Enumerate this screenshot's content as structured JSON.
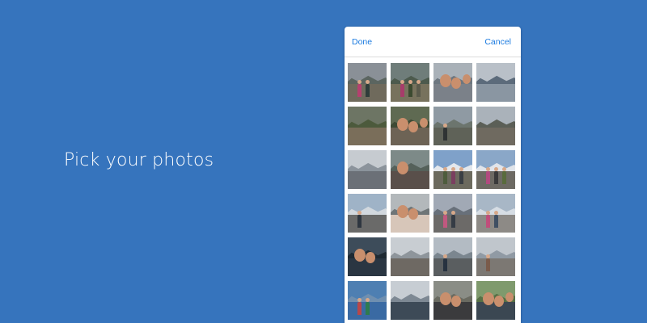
{
  "headline": "Pick your photos",
  "picker": {
    "done_label": "Done",
    "cancel_label": "Cancel",
    "accent": "#1a7ae0"
  },
  "background_color": "#3674bd",
  "photos": [
    {
      "name": "photo-hikers-mountain",
      "sky": "#8a9097",
      "mtn": "#5b6560",
      "ground": "#6f6a5c",
      "figs": [
        "#b5406f",
        "#2f3d3a"
      ]
    },
    {
      "name": "photo-group-trail",
      "sky": "#6f7d7a",
      "mtn": "#4c5a4d",
      "ground": "#77725d",
      "figs": [
        "#a73c6a",
        "#3c4a30",
        "#5b5b4c"
      ]
    },
    {
      "name": "photo-selfie-lake",
      "sky": "#a9b1b8",
      "mtn": "#6d7780",
      "ground": "#7b8189",
      "face": true
    },
    {
      "name": "photo-mountain-lake",
      "sky": "#b9c0c8",
      "mtn": "#5c6b7b",
      "ground": "#8a96a2",
      "figs": []
    },
    {
      "name": "photo-river-rocks",
      "sky": "#6d7564",
      "mtn": "#4c5a3c",
      "ground": "#7a6e5a",
      "figs": []
    },
    {
      "name": "photo-selfie-woman",
      "sky": "#5f6a52",
      "mtn": "#3e4a34",
      "ground": "#6d6355",
      "face": true
    },
    {
      "name": "photo-man-standing",
      "sky": "#8f9aa3",
      "mtn": "#6c756e",
      "ground": "#5f6258",
      "figs": [
        "#2f3334"
      ]
    },
    {
      "name": "photo-road-trees",
      "sky": "#aab2ba",
      "mtn": "#5b5f57",
      "ground": "#6f6a60",
      "figs": []
    },
    {
      "name": "photo-misty-mountain",
      "sky": "#c6cbd0",
      "mtn": "#8b939b",
      "ground": "#6b7077",
      "figs": []
    },
    {
      "name": "photo-selfie-two",
      "sky": "#7d8a88",
      "mtn": "#55615a",
      "ground": "#594f4a",
      "face": true
    },
    {
      "name": "photo-snowy-peaks",
      "sky": "#7fa1c9",
      "mtn": "#e3e7ec",
      "ground": "#6c6a5e",
      "figs": [
        "#4e5c3d",
        "#7a3f5f",
        "#3a3f44"
      ]
    },
    {
      "name": "photo-group-snow",
      "sky": "#8aa7c8",
      "mtn": "#e0e4ea",
      "ground": "#6d6a63",
      "figs": [
        "#b14a7f",
        "#3a3a3a",
        "#596b3d"
      ]
    },
    {
      "name": "photo-road-mountain",
      "sky": "#9fb3c7",
      "mtn": "#d2d8de",
      "ground": "#6a6a69",
      "figs": [
        "#2e3640"
      ]
    },
    {
      "name": "photo-woman-hat",
      "sky": "#b3b8bb",
      "mtn": "#6e7577",
      "ground": "#d7c6b9",
      "face": true
    },
    {
      "name": "photo-pair-road",
      "sky": "#a1a9b5",
      "mtn": "#68707a",
      "ground": "#6c6a68",
      "figs": [
        "#c0587f",
        "#353c45"
      ]
    },
    {
      "name": "photo-pair-snow",
      "sky": "#a8b7c6",
      "mtn": "#d6dde4",
      "ground": "#8d8a86",
      "figs": [
        "#c04e7b",
        "#3f4f63"
      ]
    },
    {
      "name": "photo-car-window",
      "sky": "#3d4c5a",
      "mtn": "#1f2a33",
      "ground": "#2a3642",
      "face": true
    },
    {
      "name": "photo-railroad",
      "sky": "#c8cdd2",
      "mtn": "#8e959b",
      "ground": "#6e6963",
      "figs": []
    },
    {
      "name": "photo-man-lake",
      "sky": "#b3bbc3",
      "mtn": "#7b868f",
      "ground": "#5a5e60",
      "figs": [
        "#273240"
      ]
    },
    {
      "name": "photo-woman-road",
      "sky": "#c0c6cc",
      "mtn": "#909aa4",
      "ground": "#7c7873",
      "figs": [
        "#7a5b4a"
      ]
    },
    {
      "name": "photo-pair-blue",
      "sky": "#4e7fb2",
      "mtn": "#6f8fb0",
      "ground": "#3a6aa3",
      "figs": [
        "#b8474a",
        "#2e7b4f"
      ]
    },
    {
      "name": "photo-lake-horizon",
      "sky": "#c7cdd3",
      "mtn": "#7d8893",
      "ground": "#3d4a57",
      "figs": []
    },
    {
      "name": "photo-group-selfie",
      "sky": "#8a8d86",
      "mtn": "#6a6b61",
      "ground": "#3b3b3d",
      "face": true
    },
    {
      "name": "photo-man-grin",
      "sky": "#7f9a6d",
      "mtn": "#567046",
      "ground": "#3b4752",
      "face": true
    }
  ]
}
